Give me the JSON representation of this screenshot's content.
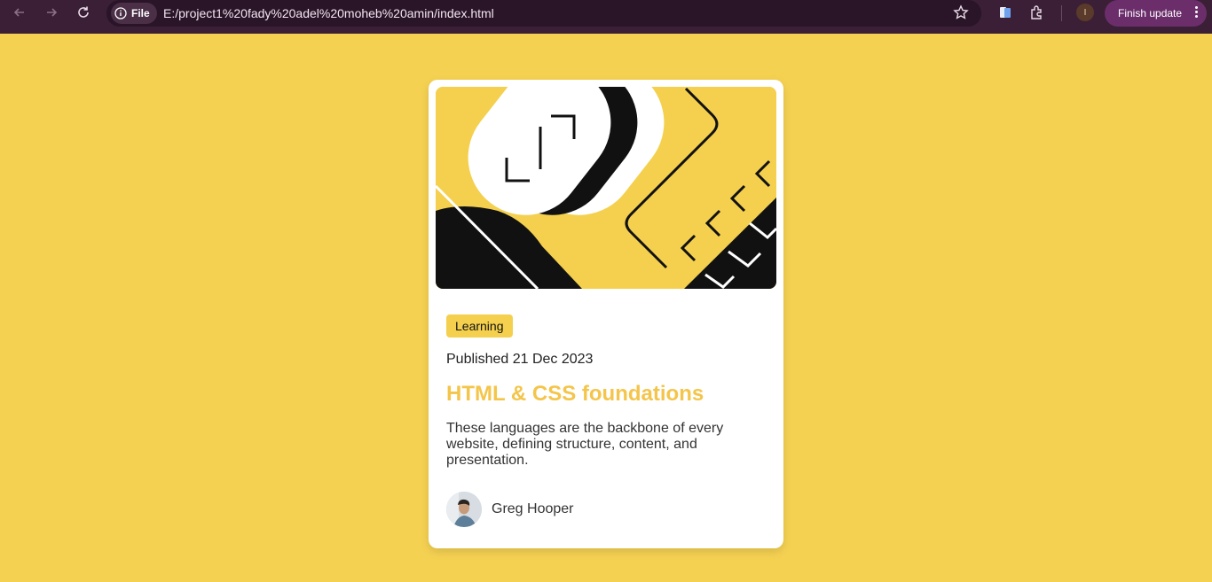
{
  "browser": {
    "site_chip_label": "File",
    "url": "E:/project1%20fady%20adel%20moheb%20amin/index.html",
    "profile_initial": "I",
    "update_button_label": "Finish update",
    "icons": [
      "back-icon",
      "forward-icon",
      "reload-icon",
      "info-icon",
      "star-icon",
      "reading-list-icon",
      "extensions-icon",
      "more-vert-icon"
    ]
  },
  "card": {
    "tag": "Learning",
    "published": "Published 21 Dec 2023",
    "title": "HTML & CSS foundations",
    "description": "These languages are the backbone of every website, defining structure, content, and presentation.",
    "author": "Greg Hooper"
  },
  "colors": {
    "page_bg": "#f5d152",
    "accent": "#f4c54a",
    "chrome_bg": "#3a1f36"
  }
}
